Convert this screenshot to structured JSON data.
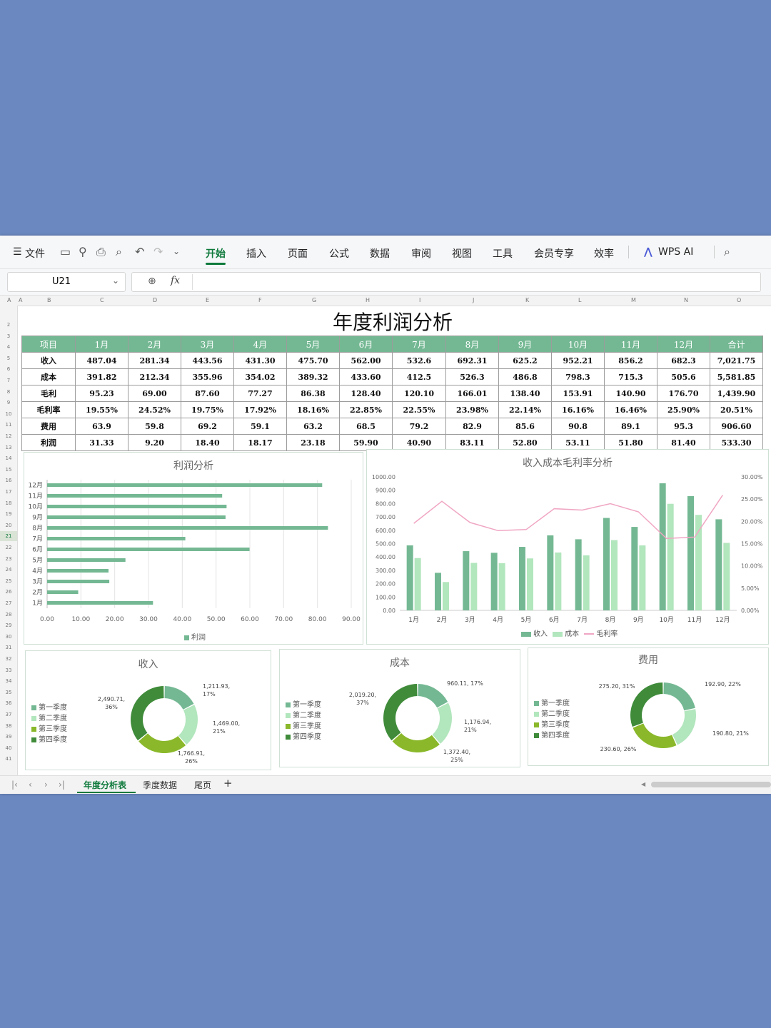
{
  "menu": {
    "file": "文件",
    "tabs": [
      "开始",
      "插入",
      "页面",
      "公式",
      "数据",
      "审阅",
      "视图",
      "工具",
      "会员专享",
      "效率"
    ],
    "active": "开始",
    "wps_ai": "WPS AI"
  },
  "formula_bar": {
    "cell_ref": "U21",
    "fx": "fx",
    "value": ""
  },
  "column_letters": [
    "A",
    "B",
    "C",
    "D",
    "E",
    "F",
    "G",
    "H",
    "I",
    "J",
    "K",
    "L",
    "M",
    "N",
    "O"
  ],
  "row_numbers": [
    "2",
    "3",
    "4",
    "5",
    "6",
    "7",
    "8",
    "9",
    "10",
    "11",
    "12",
    "13",
    "14",
    "15",
    "16",
    "17",
    "18",
    "19",
    "20",
    "21",
    "22",
    "23",
    "24",
    "25",
    "26",
    "27",
    "28",
    "29",
    "30",
    "31",
    "32",
    "33",
    "34",
    "35",
    "36",
    "37",
    "38",
    "39",
    "40",
    "41"
  ],
  "selected_row": "21",
  "title": "年度利润分析",
  "table": {
    "headers": [
      "项目",
      "1月",
      "2月",
      "3月",
      "4月",
      "5月",
      "6月",
      "7月",
      "8月",
      "9月",
      "10月",
      "11月",
      "12月",
      "合计"
    ],
    "rows": [
      [
        "收入",
        "487.04",
        "281.34",
        "443.56",
        "431.30",
        "475.70",
        "562.00",
        "532.6",
        "692.31",
        "625.2",
        "952.21",
        "856.2",
        "682.3",
        "7,021.75"
      ],
      [
        "成本",
        "391.82",
        "212.34",
        "355.96",
        "354.02",
        "389.32",
        "433.60",
        "412.5",
        "526.3",
        "486.8",
        "798.3",
        "715.3",
        "505.6",
        "5,581.85"
      ],
      [
        "毛利",
        "95.23",
        "69.00",
        "87.60",
        "77.27",
        "86.38",
        "128.40",
        "120.10",
        "166.01",
        "138.40",
        "153.91",
        "140.90",
        "176.70",
        "1,439.90"
      ],
      [
        "毛利率",
        "19.55%",
        "24.52%",
        "19.75%",
        "17.92%",
        "18.16%",
        "22.85%",
        "22.55%",
        "23.98%",
        "22.14%",
        "16.16%",
        "16.46%",
        "25.90%",
        "20.51%"
      ],
      [
        "费用",
        "63.9",
        "59.8",
        "69.2",
        "59.1",
        "63.2",
        "68.5",
        "79.2",
        "82.9",
        "85.6",
        "90.8",
        "89.1",
        "95.3",
        "906.60"
      ],
      [
        "利润",
        "31.33",
        "9.20",
        "18.40",
        "18.17",
        "23.18",
        "59.90",
        "40.90",
        "83.11",
        "52.80",
        "53.11",
        "51.80",
        "81.40",
        "533.30"
      ]
    ]
  },
  "chart_data": [
    {
      "type": "bar",
      "title": "利润分析",
      "orientation": "horizontal",
      "categories": [
        "1月",
        "2月",
        "3月",
        "4月",
        "5月",
        "6月",
        "7月",
        "8月",
        "9月",
        "10月",
        "11月",
        "12月"
      ],
      "series": [
        {
          "name": "利润",
          "values": [
            31.33,
            9.2,
            18.4,
            18.17,
            23.18,
            59.9,
            40.9,
            83.11,
            52.8,
            53.11,
            51.8,
            81.4
          ]
        }
      ],
      "xlim": [
        0,
        90
      ],
      "xticks": [
        "0.00",
        "10.00",
        "20.00",
        "30.00",
        "40.00",
        "50.00",
        "60.00",
        "70.00",
        "80.00",
        "90.00"
      ],
      "legend": "bottom",
      "colors": [
        "#74b893"
      ]
    },
    {
      "type": "bar",
      "title": "收入成本毛利率分析",
      "categories": [
        "1月",
        "2月",
        "3月",
        "4月",
        "5月",
        "6月",
        "7月",
        "8月",
        "9月",
        "10月",
        "11月",
        "12月"
      ],
      "series": [
        {
          "name": "收入",
          "type": "bar",
          "values": [
            487.04,
            281.34,
            443.56,
            431.3,
            475.7,
            562.0,
            532.6,
            692.31,
            625.2,
            952.21,
            856.2,
            682.3
          ]
        },
        {
          "name": "成本",
          "type": "bar",
          "values": [
            391.82,
            212.34,
            355.96,
            354.02,
            389.32,
            433.6,
            412.5,
            526.3,
            486.8,
            798.3,
            715.3,
            505.6
          ]
        },
        {
          "name": "毛利率",
          "type": "line",
          "axis": "right",
          "values": [
            19.55,
            24.52,
            19.75,
            17.92,
            18.16,
            22.85,
            22.55,
            23.98,
            22.14,
            16.16,
            16.46,
            25.9
          ]
        }
      ],
      "ylim": [
        0,
        1000
      ],
      "yticks": [
        "0.00",
        "100.00",
        "200.00",
        "300.00",
        "400.00",
        "500.00",
        "600.00",
        "700.00",
        "800.00",
        "900.00",
        "1000.00"
      ],
      "y2lim": [
        0,
        30
      ],
      "y2ticks": [
        "0.00%",
        "5.00%",
        "10.00%",
        "15.00%",
        "20.00%",
        "25.00%",
        "30.00%"
      ],
      "legend": "bottom",
      "colors": [
        "#74b893",
        "#b2e6bd",
        "#f0a6c3"
      ]
    },
    {
      "type": "pie",
      "title": "收入",
      "labels": [
        "第一季度",
        "第二季度",
        "第三季度",
        "第四季度"
      ],
      "values": [
        1211.93,
        1469.0,
        1766.91,
        2490.71
      ],
      "data_labels": [
        "1,211.93,\n17%",
        "1,469.00,\n21%",
        "1,766.91,\n26%",
        "2,490.71,\n36%"
      ],
      "legend": "left",
      "colors": [
        "#74b893",
        "#b2e6bd",
        "#8ab82a",
        "#3f8b3a"
      ]
    },
    {
      "type": "pie",
      "title": "成本",
      "labels": [
        "第一季度",
        "第二季度",
        "第三季度",
        "第四季度"
      ],
      "values": [
        960.11,
        1176.94,
        1372.4,
        2019.2
      ],
      "data_labels": [
        "960.11, 17%",
        "1,176.94,\n21%",
        "1,372.40,\n25%",
        "2,019.20,\n37%"
      ],
      "legend": "left",
      "colors": [
        "#74b893",
        "#b2e6bd",
        "#8ab82a",
        "#3f8b3a"
      ]
    },
    {
      "type": "pie",
      "title": "费用",
      "labels": [
        "第一季度",
        "第二季度",
        "第三季度",
        "第四季度"
      ],
      "values": [
        192.9,
        190.8,
        230.6,
        275.2
      ],
      "data_labels": [
        "192.90, 22%",
        "190.80, 21%",
        "230.60, 26%",
        "275.20, 31%"
      ],
      "legend": "left",
      "colors": [
        "#74b893",
        "#b2e6bd",
        "#8ab82a",
        "#3f8b3a"
      ]
    }
  ],
  "sheet_tabs": {
    "items": [
      "年度分析表",
      "季度数据",
      "尾页"
    ],
    "active": "年度分析表",
    "add": "+"
  }
}
